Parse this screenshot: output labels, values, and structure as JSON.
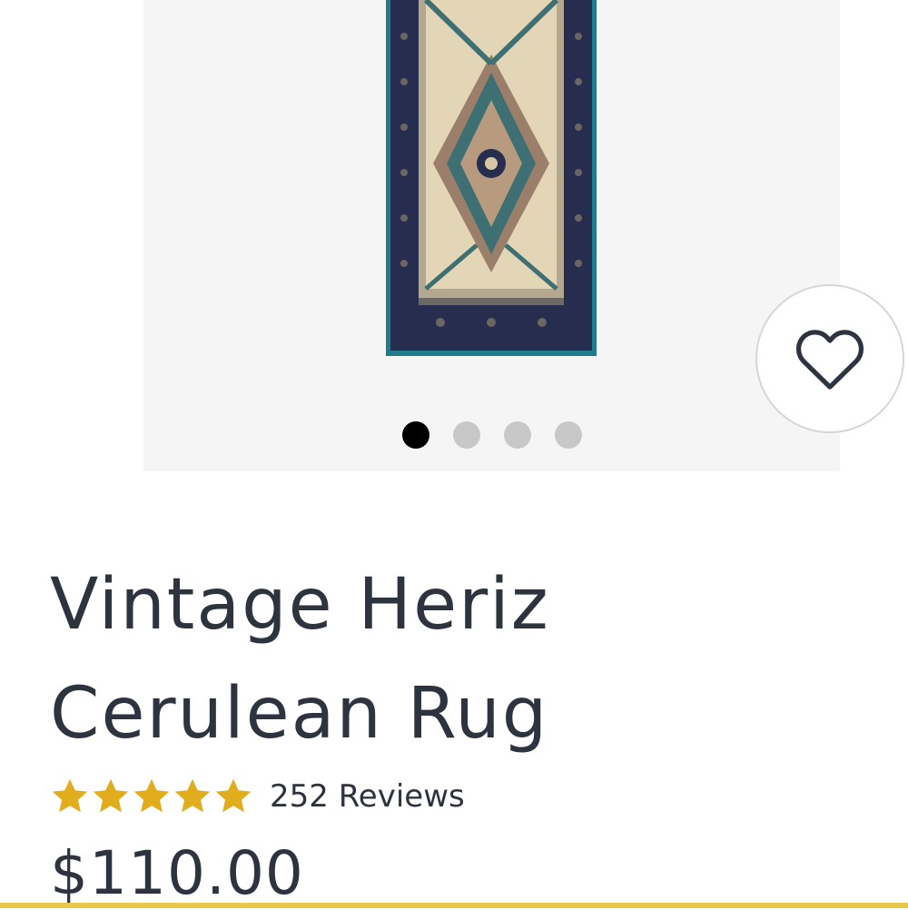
{
  "gallery": {
    "slide_count": 4,
    "active_slide": 1
  },
  "favorite": {
    "icon": "heart-outline-icon"
  },
  "product": {
    "title_line1": "Vintage Heriz",
    "title_line2": "Cerulean Rug",
    "rating": 5,
    "reviews_label": "252 Reviews",
    "price": "$110.00"
  },
  "colors": {
    "star": "#e1ad1c",
    "text": "#2e3340",
    "active_dot": "#000000",
    "inactive_dot": "#c8c8c8",
    "rug_border": "#1f7c8c",
    "rug_navy": "#262d4f",
    "rug_cream": "#e3d6b7",
    "bottom_bar": "#e9c74a"
  }
}
